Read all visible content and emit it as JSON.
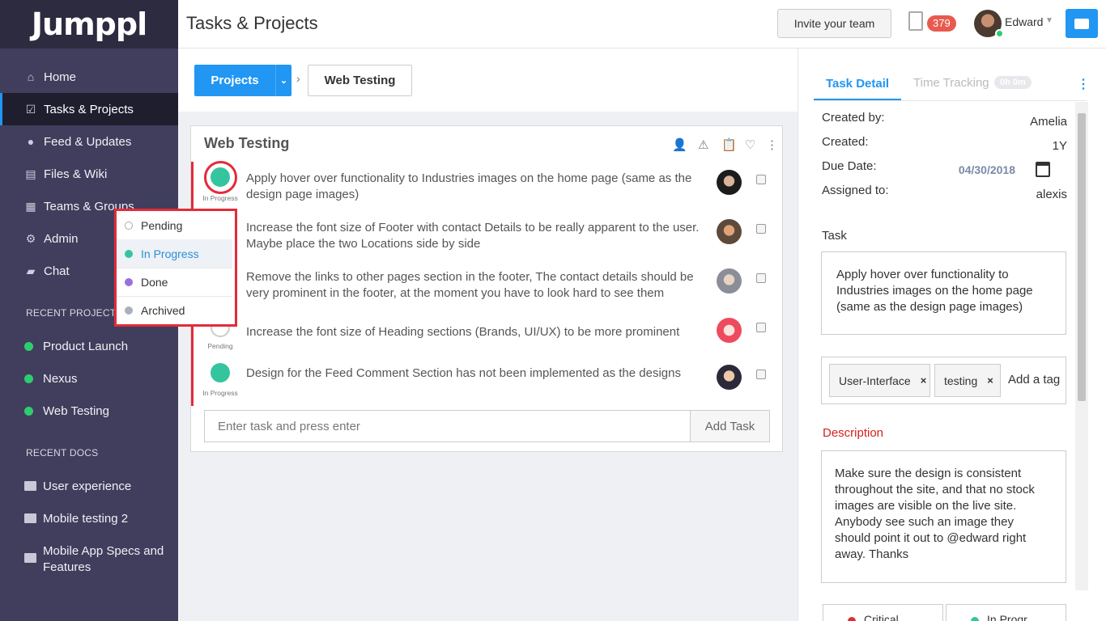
{
  "app": {
    "logo": "Jumppl"
  },
  "sidebar": {
    "items": [
      {
        "label": "Home",
        "icon": "home-icon"
      },
      {
        "label": "Tasks & Projects",
        "icon": "checkbox-icon"
      },
      {
        "label": "Feed & Updates",
        "icon": "speech-bubble-icon"
      },
      {
        "label": "Files & Wiki",
        "icon": "file-icon"
      },
      {
        "label": "Teams & Groups",
        "icon": "grid-icon"
      },
      {
        "label": "Admin",
        "icon": "gears-icon"
      },
      {
        "label": "Chat",
        "icon": "chat-icon"
      }
    ],
    "recent_projects_title": "RECENT PROJECTS",
    "recent_projects": [
      "Product Launch",
      "Nexus",
      "Web Testing"
    ],
    "recent_docs_title": "RECENT DOCS",
    "recent_docs": [
      "User experience",
      "Mobile testing 2",
      "Mobile App Specs and Features"
    ]
  },
  "header": {
    "title": "Tasks & Projects",
    "invite_label": "Invite your team",
    "notification_count": "379",
    "user_name": "Edward"
  },
  "breadcrumb": {
    "projects_label": "Projects",
    "current": "Web Testing"
  },
  "panel": {
    "title": "Web Testing",
    "tasks": [
      {
        "text": "Apply hover over functionality to Industries images on the home page (same as the design page images)",
        "status": "In Progress"
      },
      {
        "text": "Increase the font size of Footer with contact Details to be really apparent to the user. Maybe place the two Locations side by side",
        "status": ""
      },
      {
        "text": "Remove the links to other pages section in the footer, The contact details should be very prominent in the footer, at the moment you have to look hard to see them",
        "status": ""
      },
      {
        "text": "Increase the font size of Heading sections (Brands, UI/UX) to be more prominent",
        "status": "Pending"
      },
      {
        "text": "Design for the Feed Comment Section has not been implemented as the designs",
        "status": "In Progress"
      }
    ],
    "input_placeholder": "Enter task and press enter",
    "add_task_label": "Add Task"
  },
  "status_dropdown": {
    "options": [
      {
        "label": "Pending",
        "color": "#ffffff"
      },
      {
        "label": "In Progress",
        "color": "#35c59e"
      },
      {
        "label": "Done",
        "color": "#9b6fe0"
      },
      {
        "label": "Archived",
        "color": "#a9b0bd"
      }
    ],
    "selected": "In Progress"
  },
  "detail": {
    "tab_detail": "Task Detail",
    "tab_time": "Time Tracking",
    "time_badge": "0h 0m",
    "created_by_label": "Created by:",
    "created_by": "Amelia",
    "created_label": "Created:",
    "created": "1Y",
    "due_label": "Due Date:",
    "due": "04/30/2018",
    "assigned_label": "Assigned to:",
    "assigned": "alexis",
    "task_label": "Task",
    "task_text": "Apply hover over functionality to Industries images on the home page (same as the design page images)",
    "tags": [
      "User-Interface",
      "testing"
    ],
    "add_tag": "Add a tag",
    "description_label": "Description",
    "description": "Make sure the design is consistent throughout the site, and that no stock images are visible on the live site. Anybody see such an image they should point it out to @edward right away. Thanks",
    "priority": "Critical",
    "status": "In Progr"
  },
  "colors": {
    "accent": "#2196f3",
    "sidebar": "#403e5c",
    "in_progress": "#35c59e",
    "highlight": "#e32b3a"
  }
}
